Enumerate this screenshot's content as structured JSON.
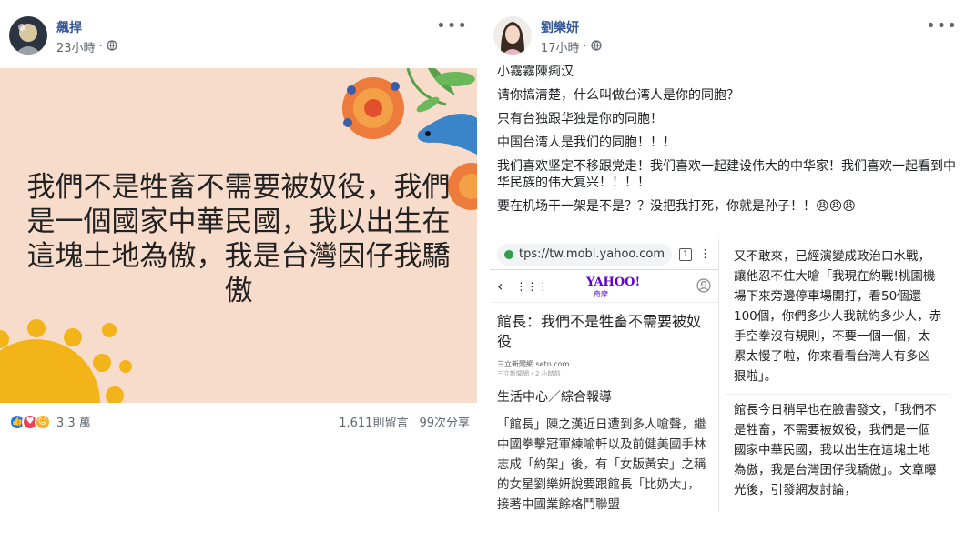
{
  "left_post": {
    "author": "飆捍",
    "time": "23小時",
    "image_text": "我們不是牲畜不需要被奴役，我們是一個國家中華民國，我以出生在這塊土地為傲，我是台灣因仔我驕傲",
    "reaction_count": "3.3 萬",
    "comments": "1,611則留言",
    "shares": "99次分享",
    "colors": {
      "image_bg": "#f8dccb",
      "accent": "#385898"
    }
  },
  "right_post": {
    "author": "劉樂妍",
    "time": "17小時",
    "lines": [
      "小霧霧陳痢汉",
      "请你搞清楚，什么叫做台湾人是你的同胞？",
      "只有台独跟华独是你的同胞！",
      "中国台湾人是我们的同胞！！！",
      "我们喜欢坚定不移跟党走！我们喜欢一起建设伟大的中华家！我们喜欢一起看到中华民族的伟大复兴！！！！",
      "要在机场干一架是不是？？没把我打死，你就是孙子！！😠😠😠"
    ]
  },
  "embedded": {
    "url": "tps://tw.mobi.yahoo.com",
    "tab_count": "1",
    "yahoo_logo": "YAHOO!",
    "yahoo_sub": "奇摩",
    "article_title": "館長：我們不是牲畜不需要被奴役",
    "source": "三立新聞網 setn.com",
    "source_time": "三立新聞網・2 小時前",
    "section": "生活中心／綜合報導",
    "article_body": "「館長」陳之漢近日遭到多人嗆聲，繼中國拳擊冠軍練喻軒以及前健美國手林志成「約架」後，有「女版黃安」之稱的女星劉樂妍說要跟館長「比奶大」，接著中國業餘格鬥聯盟",
    "right_top": "又不敢來，已經演變成政治口水戰，讓他忍不住大嗆「我現在約戰!桃園機場下來旁邊停車場開打，看50個還100個，你們多少人我就約多少人，赤手空拳沒有規則，不要一個一個，太累太慢了啦，你來看看台灣人有多凶狠啦」。",
    "right_bottom": "館長今日稍早也在臉書發文，「我們不是牲畜，不需要被奴役，我們是一個國家中華民國，我以出生在這塊土地為傲，我是台灣囝仔我驕傲」。文章曝光後，引發網友討論，"
  }
}
